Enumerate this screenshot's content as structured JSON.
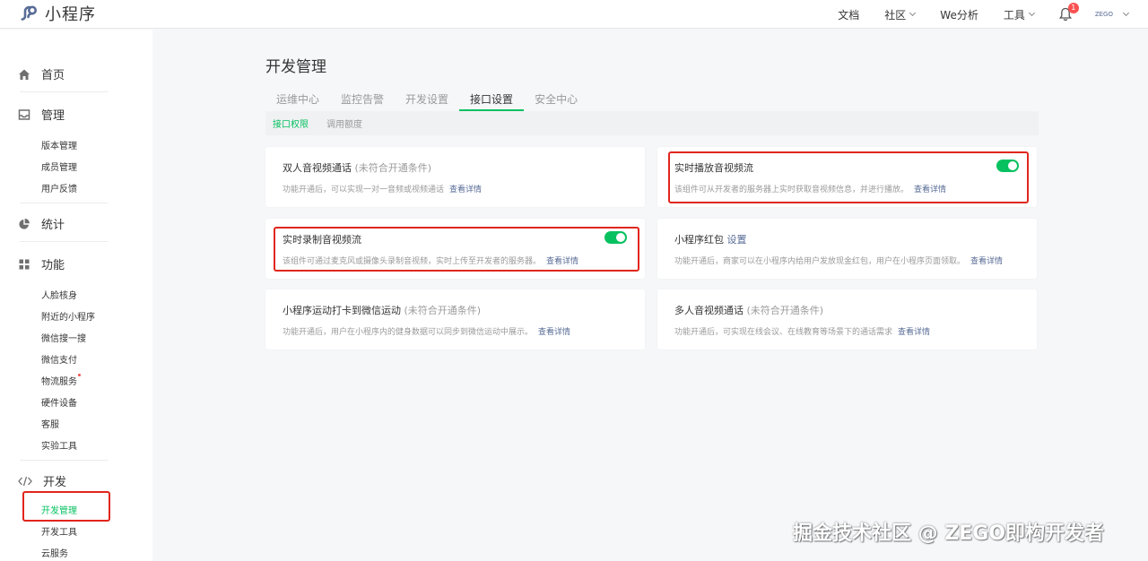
{
  "app": {
    "logo_icon": "mini-program-logo-icon",
    "name": "小程序",
    "brand_color": "#576b95",
    "accent_color": "#07c160",
    "highlight_color": "#e0261d"
  },
  "topnav": {
    "docs": "文档",
    "community": "社区",
    "we_analysis": "We分析",
    "tools": "工具",
    "notification_count": "1",
    "account": "ZEGO"
  },
  "sidebar": {
    "home": "首页",
    "manage": "管理",
    "manage_items": [
      "版本管理",
      "成员管理",
      "用户反馈"
    ],
    "stats": "统计",
    "features": "功能",
    "feature_items": [
      "人脸核身",
      "附近的小程序",
      "微信搜一搜",
      "微信支付",
      "物流服务",
      "硬件设备",
      "客服",
      "实验工具"
    ],
    "develop": "开发",
    "develop_items": [
      "开发管理",
      "开发工具",
      "云服务"
    ]
  },
  "main": {
    "title": "开发管理",
    "tabs": [
      "运维中心",
      "监控告警",
      "开发设置",
      "接口设置",
      "安全中心"
    ],
    "active_tab": "接口设置",
    "subtabs": [
      "接口权限",
      "调用额度"
    ],
    "cards": [
      {
        "title": "双人音视频通话",
        "condition": "(未符合开通条件)",
        "desc": "功能开通后，可以实现一对一音频或视频通话",
        "link": "查看详情"
      },
      {
        "title": "实时播放音视频流",
        "desc": "该组件可从开发者的服务器上实时获取音视频信息，并进行播放。",
        "link": "查看详情",
        "enabled": true
      },
      {
        "title": "实时录制音视频流",
        "desc": "该组件可通过麦克风或摄像头录制音视频，实时上传至开发者的服务器。",
        "link": "查看详情",
        "enabled": true
      },
      {
        "title": "小程序红包",
        "setting": "设置",
        "desc": "功能开通后，商家可以在小程序内给用户发放现金红包，用户在小程序页面领取。",
        "link": "查看详情"
      },
      {
        "title": "小程序运动打卡到微信运动",
        "condition": "(未符合开通条件)",
        "desc": "功能开通后，用户在小程序内的健身数据可以同步到微信运动中展示。",
        "link": "查看详情"
      },
      {
        "title": "多人音视频通话",
        "condition": "(未符合开通条件)",
        "desc": "功能开通后，可实现在线会议、在线教育等场景下的通话需求",
        "link": "查看详情"
      }
    ]
  },
  "watermark": "掘金技术社区 @ ZEGO即构开发者"
}
